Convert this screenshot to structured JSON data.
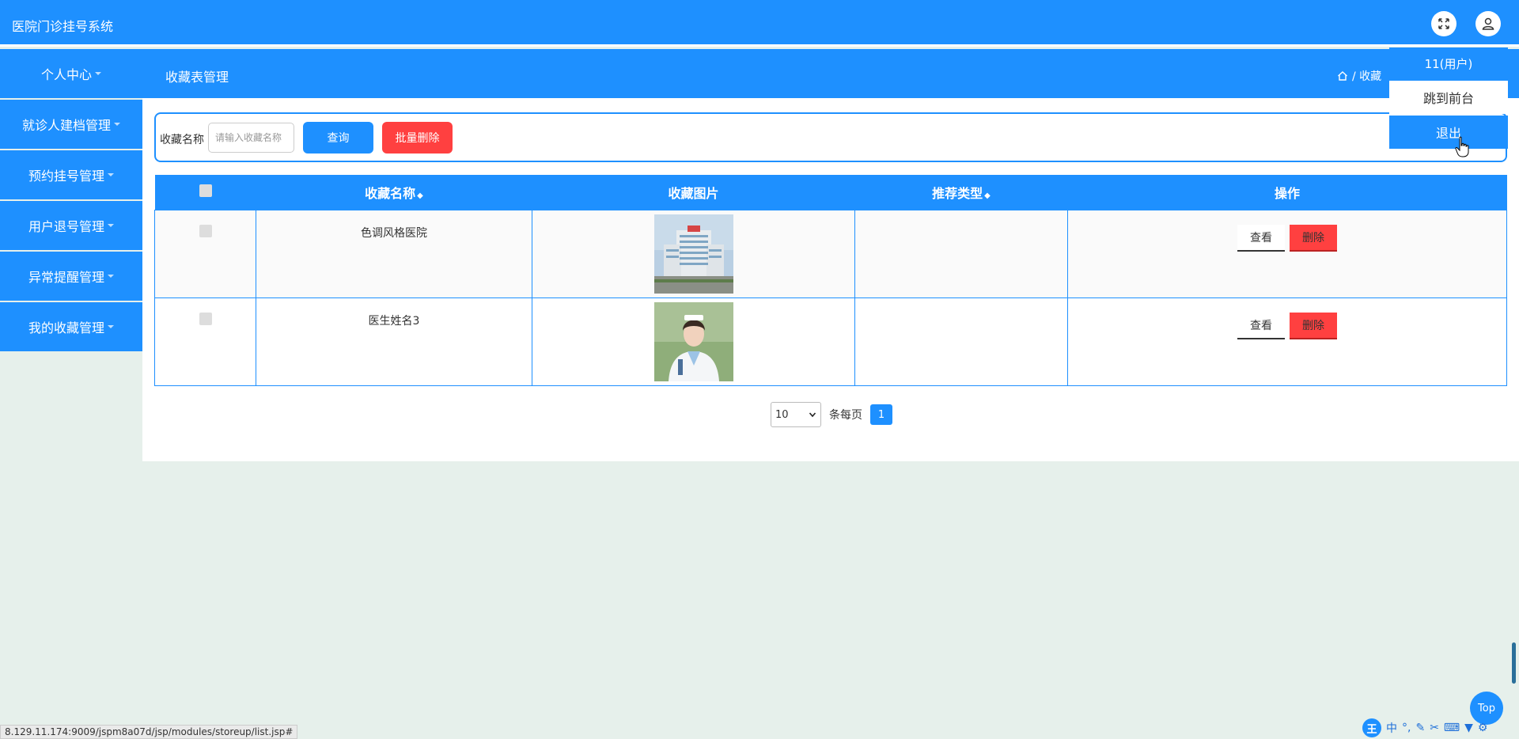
{
  "app": {
    "title": "医院门诊挂号系统"
  },
  "header": {
    "fullscreen_icon": "fullscreen-icon",
    "user_icon": "user-icon"
  },
  "navbar": {
    "personal_center": "个人中心",
    "page_heading": "收藏表管理",
    "breadcrumb": "/ 收藏"
  },
  "sidebar": {
    "items": [
      {
        "label": "就诊人建档管理"
      },
      {
        "label": "预约挂号管理"
      },
      {
        "label": "用户退号管理"
      },
      {
        "label": "异常提醒管理"
      },
      {
        "label": "我的收藏管理"
      }
    ]
  },
  "search": {
    "label": "收藏名称",
    "placeholder": "请输入收藏名称",
    "query_label": "查询",
    "batch_delete_label": "批量删除"
  },
  "table": {
    "columns": [
      "收藏名称",
      "收藏图片",
      "推荐类型",
      "操作"
    ],
    "rows": [
      {
        "name": "色调风格医院",
        "image": "hospital-building-photo",
        "type": "",
        "view_label": "查看",
        "delete_label": "删除"
      },
      {
        "name": "医生姓名3",
        "image": "doctor-portrait-photo",
        "type": "",
        "view_label": "查看",
        "delete_label": "删除"
      }
    ]
  },
  "pagination": {
    "page_size": "10",
    "per_page_label": "条每页",
    "current_page": "1"
  },
  "dropdown": {
    "user_label": "11(用户)",
    "front_label": "跳到前台",
    "logout_label": "退出"
  },
  "top_button": "Top",
  "status_url": "8.129.11.174:9009/jspm8a07d/jsp/modules/storeup/list.jsp#",
  "ime": {
    "logo": "王",
    "mode": "中"
  },
  "colors": {
    "primary": "#1e90ff",
    "danger": "#ff4040",
    "background": "#e6f0eb"
  }
}
